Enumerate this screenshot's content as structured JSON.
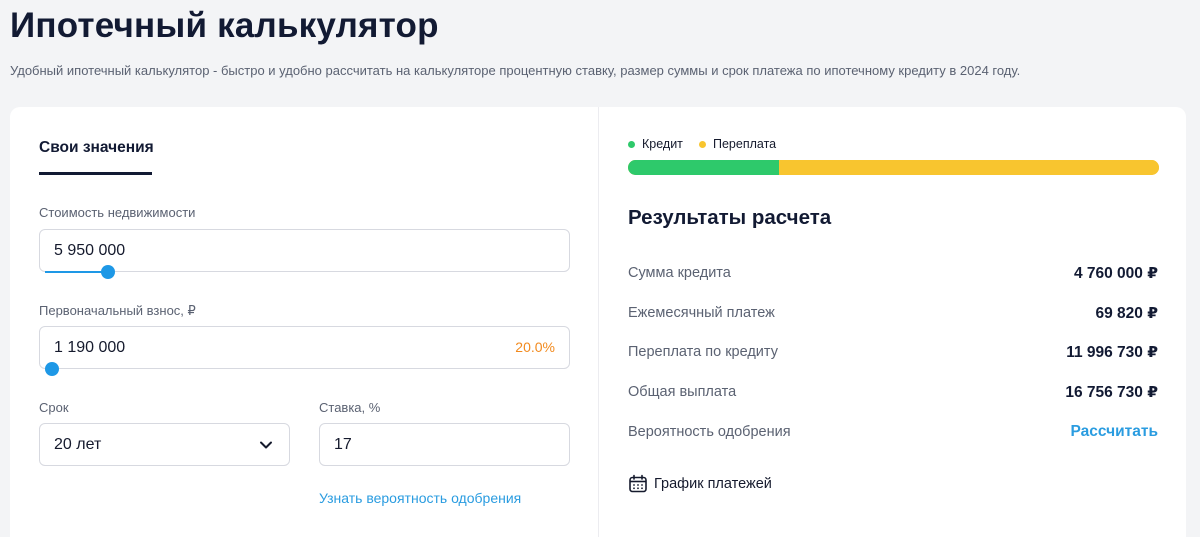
{
  "header": {
    "title": "Ипотечный калькулятор",
    "subtitle": "Удобный ипотечный калькулятор - быстро и удобно рассчитать на калькуляторе процентную ставку, размер суммы и срок платежа по ипотечному кредиту в 2024 году."
  },
  "form": {
    "tab_label": "Свои значения",
    "property_cost": {
      "label": "Стоимость недвижимости",
      "value": "5 950 000",
      "slider_fraction": 0.12
    },
    "down_payment": {
      "label": "Первоначальный взнос, ₽",
      "value": "1 190 000",
      "percent": "20.0%",
      "slider_fraction": 0.0
    },
    "term": {
      "label": "Срок",
      "value": "20 лет"
    },
    "rate": {
      "label": "Ставка, %",
      "value": "17"
    },
    "approval_link": "Узнать вероятность одобрения"
  },
  "results": {
    "legend": {
      "credit": "Кредит",
      "overpayment": "Переплата"
    },
    "colors": {
      "credit": "#2ec96b",
      "overpayment": "#f8c52f"
    },
    "credit_share": 0.284,
    "title": "Результаты расчета",
    "rows": [
      {
        "label": "Сумма кредита",
        "value": "4 760 000 ₽"
      },
      {
        "label": "Ежемесячный платеж",
        "value": "69 820 ₽"
      },
      {
        "label": "Переплата по кредиту",
        "value": "11 996 730 ₽"
      },
      {
        "label": "Общая выплата",
        "value": "16 756 730 ₽"
      },
      {
        "label": "Вероятность одобрения",
        "value": "Рассчитать"
      }
    ],
    "schedule_label": "График платежей",
    "schedule_icon": "calendar-icon"
  }
}
